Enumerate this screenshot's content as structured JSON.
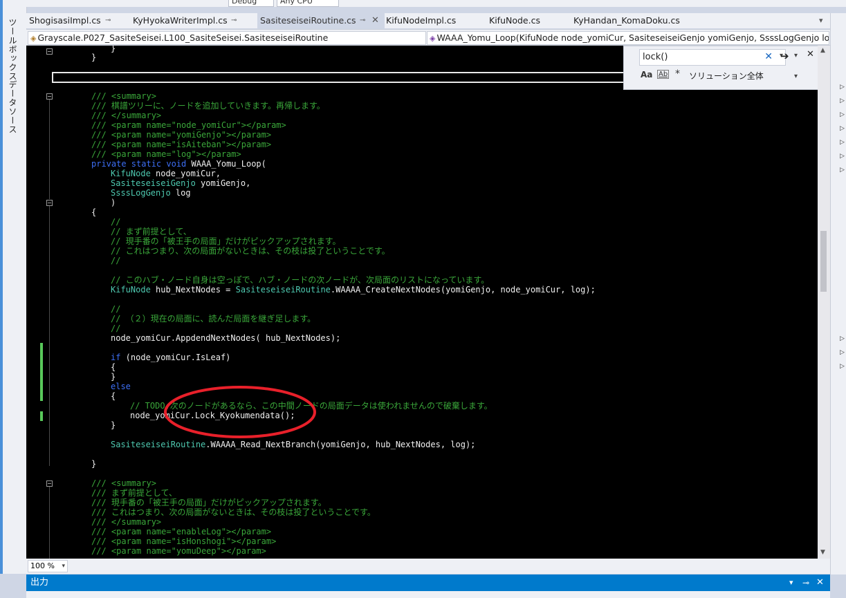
{
  "toolbox": {
    "tab1": "ツールボックス",
    "tab2": "データソース"
  },
  "toolbar": {
    "config": "Debug",
    "platform": "Any CPU"
  },
  "tabs": [
    {
      "label": "ShogisasiImpl.cs"
    },
    {
      "label": "KyHyokaWriterImpl.cs"
    },
    {
      "label": "SasiteseiseiRoutine.cs"
    },
    {
      "label": "KifuNodeImpl.cs"
    },
    {
      "label": "KifuNode.cs"
    },
    {
      "label": "KyHandan_KomaDoku.cs"
    }
  ],
  "nav": {
    "class_path": "Grayscale.P027_SasiteSeisei.L100_SasiteSeisei.SasiteseiseiRoutine",
    "member": "WAAA_Yomu_Loop(KifuNode node_yomiCur, SasiteseiseiGenjo yomiGenjo, SsssLogGenjo log"
  },
  "find": {
    "query": "lock()",
    "scope": "ソリューション全体",
    "opt_case": "Aa",
    "opt_word": "Ab"
  },
  "code": {
    "l0": "}",
    "l1": "}",
    "doc1": "/// <summary>",
    "doc2": "/// 棋譜ツリーに、ノードを追加していきます。再帰します。",
    "doc3": "/// </summary>",
    "doc4": "/// <param name=\"node_yomiCur\"></param>",
    "doc5": "/// <param name=\"yomiGenjo\"></param>",
    "doc6": "/// <param name=\"isAiteban\"></param>",
    "doc7": "/// <param name=\"log\"></param>",
    "sig_kw": "private static void",
    "sig_name": " WAAA_Yomu_Loop(",
    "p1_ty": "KifuNode",
    "p1_name": " node_yomiCur,",
    "p2_ty": "SasiteseiseiGenjo",
    "p2_name": " yomiGenjo,",
    "p3_ty": "SsssLogGenjo",
    "p3_name": " log",
    "paren": ")",
    "open": "{",
    "c1": "//",
    "c2": "// まず前提として、",
    "c3": "// 現手番の「被王手の局面」だけがピックアップされます。",
    "c4": "// これはつまり、次の局面がないときは、その枝は投了ということです。",
    "c5": "//",
    "c6": "// このハブ・ノード自身は空っぽで、ハブ・ノードの次ノードが、次局面のリストになっています。",
    "hub_ty": "KifuNode",
    "hub_mid": " hub_NextNodes = ",
    "hub_ty2": "SasiteseiseiRoutine",
    "hub_rest": ".WAAAA_CreateNextNodes(yomiGenjo, node_yomiCur, log);",
    "c7": "//",
    "c8": "// （２）現在の局面に、読んだ局面を継ぎ足します。",
    "c9": "//",
    "append": "node_yomiCur.AppdendNextNodes( hub_NextNodes);",
    "if_kw": "if",
    "if_rest": " (node_yomiCur.IsLeaf)",
    "b1": "{",
    "b2": "}",
    "else_kw": "else",
    "b3": "{",
    "todo": "// TODO:次のノードがあるなら、この中間ノードの局面データは使われませんので破棄します。",
    "lock": "node_yomiCur.Lock_Kyokumendata();",
    "b4": "}",
    "read_ty": "SasiteseiseiRoutine",
    "read_rest": ".WAAAA_Read_NextBranch(yomiGenjo, hub_NextNodes, log);",
    "close": "}",
    "d2_1": "/// <summary>",
    "d2_2": "/// まず前提として、",
    "d2_3": "/// 現手番の「被王手の局面」だけがピックアップされます。",
    "d2_4": "/// これはつまり、次の局面がないときは、その枝は投了ということです。",
    "d2_5": "/// </summary>",
    "d2_6": "/// <param name=\"enableLog\"></param>",
    "d2_7": "/// <param name=\"isHonshogi\"></param>",
    "d2_8": "/// <param name=\"yomuDeep\"></param>"
  },
  "zoom": "100 %",
  "output": {
    "title": "出力"
  },
  "colors": {
    "accent": "#007acc",
    "annotation": "#e8202a"
  }
}
